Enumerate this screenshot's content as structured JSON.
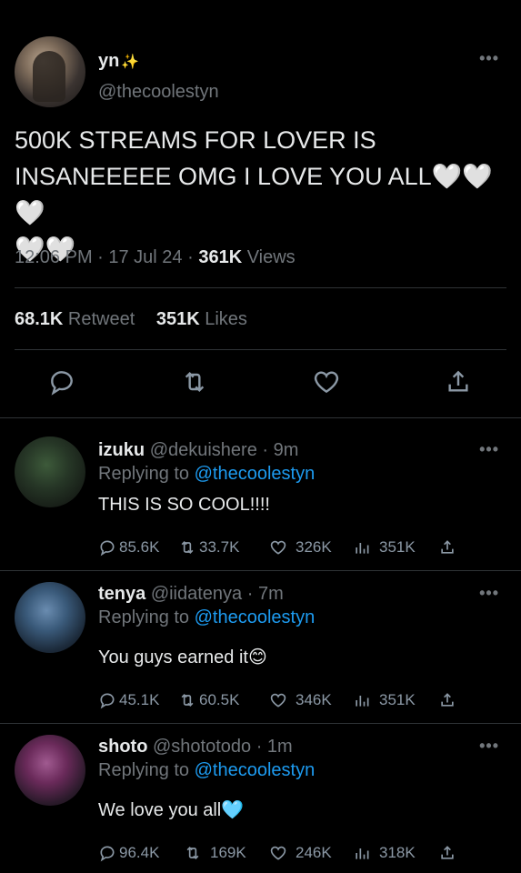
{
  "main_tweet": {
    "author_name": "yn",
    "author_emoji": "✨",
    "handle": "@thecoolestyn",
    "text_line1": "500K STREAMS FOR LOVER IS",
    "text_line2": "INSANEEEEE OMG I LOVE YOU ALL",
    "text_hearts_line2": "🤍🤍🤍",
    "text_hearts_line3": "🤍🤍",
    "time": "12:06 PM · 17 Jul 24 · ",
    "views_count": "361K",
    "views_label": " Views",
    "retweets_count": "68.1K",
    "retweets_label": " Retweet",
    "likes_count": "351K",
    "likes_label": " Likes",
    "more": "•••"
  },
  "replies": [
    {
      "name": "izuku",
      "handle": "@dekuishere",
      "time": " · 9m",
      "replying_prefix": "Replying to ",
      "replying_to": "@thecoolestyn",
      "text": "THIS IS SO COOL!!!!",
      "comments": "85.6K",
      "retweets": "33.7K",
      "likes": "326K",
      "views": "351K",
      "more": "•••",
      "avatar_color": "#2e4a2e"
    },
    {
      "name": "tenya",
      "handle": "@iidatenya",
      "time": " · 7m",
      "replying_prefix": "Replying to ",
      "replying_to": "@thecoolestyn",
      "text": "You guys earned it",
      "emoji": "😊",
      "comments": "45.1K",
      "retweets": "60.5K",
      "likes": "346K",
      "views": "351K",
      "more": "•••",
      "avatar_color": "#4a6a8c"
    },
    {
      "name": "shoto",
      "handle": "@shototodo",
      "time": " · 1m",
      "replying_prefix": "Replying to ",
      "replying_to": "@thecoolestyn",
      "text": "We love you all",
      "emoji": "🩵",
      "comments": "96.4K",
      "retweets": "169K",
      "likes": "246K",
      "views": "318K",
      "more": "•••",
      "avatar_color": "#7a3a6a"
    }
  ]
}
